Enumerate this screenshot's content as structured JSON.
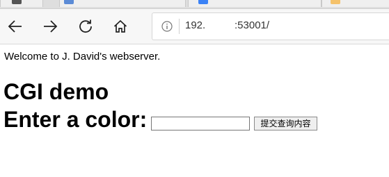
{
  "browser": {
    "address_bar": {
      "url_host": "192.",
      "url_port": ":53001/"
    }
  },
  "page": {
    "welcome_text": "Welcome to J. David's webserver.",
    "title": "CGI demo",
    "form": {
      "color_label": "Enter a color:",
      "color_value": "",
      "submit_label": "提交查询内容"
    }
  },
  "colors": {
    "tab_icon_1": "#5b8bd6",
    "tab_icon_2": "#3b82f6",
    "tab_icon_3": "#f5c26b"
  }
}
